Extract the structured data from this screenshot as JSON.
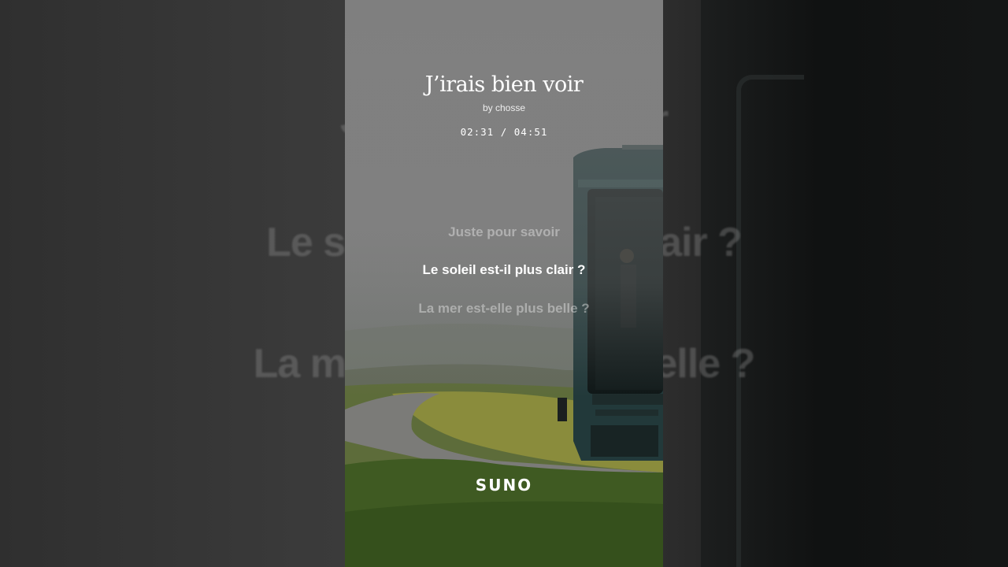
{
  "song": {
    "title": "J’irais bien voir",
    "byline": "by chosse",
    "elapsed": "02:31",
    "separator": "/",
    "duration": "04:51",
    "time_display": "02:31 / 04:51",
    "progress_fraction": 0.519
  },
  "lyrics": {
    "previous": "Juste pour savoir",
    "current": "Le soleil est-il plus clair ?",
    "next": "La mer est-elle plus belle ?"
  },
  "background_lyrics": {
    "line1": "Juste pour savoir",
    "line2": "Le soleil est-il plus clair ?",
    "line3": "La mer est-elle plus belle ?"
  },
  "brand": {
    "logo_text": "SUNO"
  },
  "colors": {
    "text": "#ffffff",
    "dim_text": "#bdbdbd",
    "sky": "#808080",
    "grass": "#4c6a2c",
    "train": "#1f3232"
  }
}
